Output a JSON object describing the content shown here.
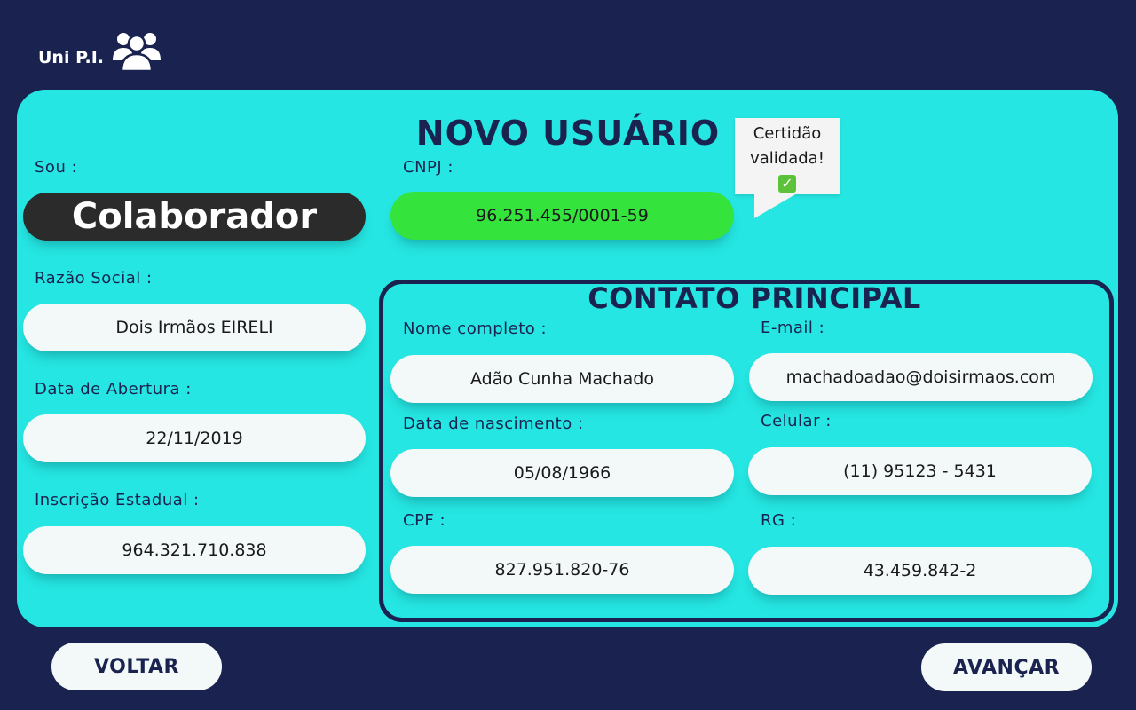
{
  "brand": {
    "name": "Uni P.I.",
    "icon": "users-group-icon"
  },
  "page": {
    "title": "NOVO USUÁRIO"
  },
  "role": {
    "label": "Sou :",
    "value": "Colaborador"
  },
  "cnpj": {
    "label": "CNPJ :",
    "value": "96.251.455/0001-59"
  },
  "certificate_tooltip": {
    "line1": "Certidão",
    "line2": "validada!",
    "icon": "check-icon",
    "icon_glyph": "✓"
  },
  "company": {
    "razao_social": {
      "label": "Razão Social :",
      "value": "Dois Irmãos EIRELI"
    },
    "data_abertura": {
      "label": "Data de Abertura :",
      "value": "22/11/2019"
    },
    "inscricao_estadual": {
      "label": "Inscrição Estadual :",
      "value": "964.321.710.838"
    }
  },
  "contact": {
    "title": "CONTATO PRINCIPAL",
    "nome": {
      "label": "Nome completo :",
      "value": "Adão Cunha Machado"
    },
    "email": {
      "label": "E-mail :",
      "value": "machadoadao@doisirmaos.com"
    },
    "nascimento": {
      "label": "Data de nascimento :",
      "value": "05/08/1966"
    },
    "celular": {
      "label": "Celular :",
      "value": "(11) 95123 - 5431"
    },
    "cpf": {
      "label": "CPF :",
      "value": "827.951.820-76"
    },
    "rg": {
      "label": "RG :",
      "value": "43.459.842-2"
    }
  },
  "buttons": {
    "back": "VOLTAR",
    "next": "AVANÇAR"
  },
  "colors": {
    "background": "#1a2350",
    "panel": "#25e6e2",
    "valid": "#34e33c",
    "role_bg": "#2b2b2b"
  }
}
